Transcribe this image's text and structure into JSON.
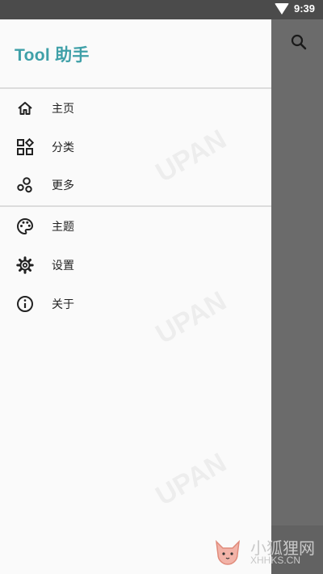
{
  "status": {
    "time": "9:39"
  },
  "drawer": {
    "title": "Tool 助手",
    "items": [
      {
        "label": "主页"
      },
      {
        "label": "分类"
      },
      {
        "label": "更多"
      },
      {
        "label": "主题"
      },
      {
        "label": "设置"
      },
      {
        "label": "关于"
      }
    ]
  },
  "watermark": {
    "text": "UPAN",
    "site_name": "小狐狸网",
    "site_domain": "XHHKS.CN"
  },
  "colors": {
    "brand": "#3fa0a8",
    "scrim": "#6b6b6b",
    "drawer_bg": "#fafafa"
  },
  "icons": [
    "home-icon",
    "category-icon",
    "more-icon",
    "palette-icon",
    "gear-icon",
    "info-icon",
    "search-icon",
    "wifi-icon"
  ]
}
